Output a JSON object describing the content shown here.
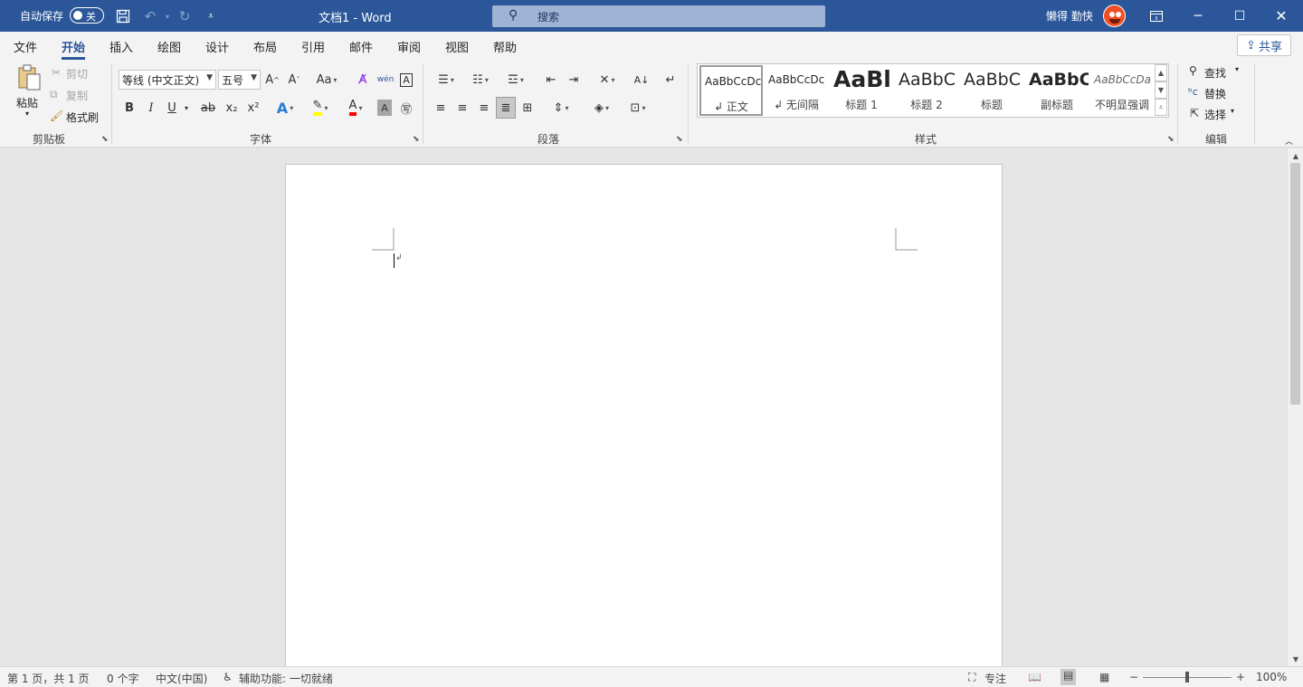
{
  "titlebar": {
    "autosave_label": "自动保存",
    "autosave_state": "关",
    "document_title": "文档1  -  Word",
    "search_placeholder": "搜索",
    "user_name": "懒得 勤快"
  },
  "tabs": [
    "文件",
    "开始",
    "插入",
    "绘图",
    "设计",
    "布局",
    "引用",
    "邮件",
    "审阅",
    "视图",
    "帮助"
  ],
  "active_tab": "开始",
  "share_label": "共享",
  "clipboard": {
    "paste": "粘贴",
    "cut": "剪切",
    "copy": "复制",
    "format_painter": "格式刷",
    "group_label": "剪贴板"
  },
  "font": {
    "font_name": "等线 (中文正文)",
    "font_size": "五号",
    "grow": "A^",
    "shrink": "Aˇ",
    "change_case": "Aa",
    "bold": "B",
    "italic": "I",
    "underline": "U",
    "strikethrough": "ab",
    "subscript": "x₂",
    "superscript": "x²",
    "group_label": "字体"
  },
  "paragraph": {
    "group_label": "段落"
  },
  "styles": {
    "items": [
      {
        "sample": "AaBbCcDc",
        "name": "↲ 正文"
      },
      {
        "sample": "AaBbCcDc",
        "name": "↲ 无间隔"
      },
      {
        "sample": "AaBl",
        "name": "标题 1"
      },
      {
        "sample": "AaBbC",
        "name": "标题 2"
      },
      {
        "sample": "AaBbC",
        "name": "标题"
      },
      {
        "sample": "AaBbC",
        "name": "副标题"
      },
      {
        "sample": "AaBbCcDa",
        "name": "不明显强调"
      }
    ],
    "group_label": "样式"
  },
  "editing": {
    "find": "查找",
    "replace": "替换",
    "select": "选择",
    "group_label": "编辑"
  },
  "status": {
    "page": "第 1 页，共 1 页",
    "words": "0 个字",
    "language": "中文(中国)",
    "accessibility": "辅助功能: 一切就绪",
    "focus": "专注",
    "zoom": "100%"
  },
  "colors": {
    "accent": "#2b579a",
    "highlight": "#ffff00",
    "font_color": "#ff0000"
  }
}
